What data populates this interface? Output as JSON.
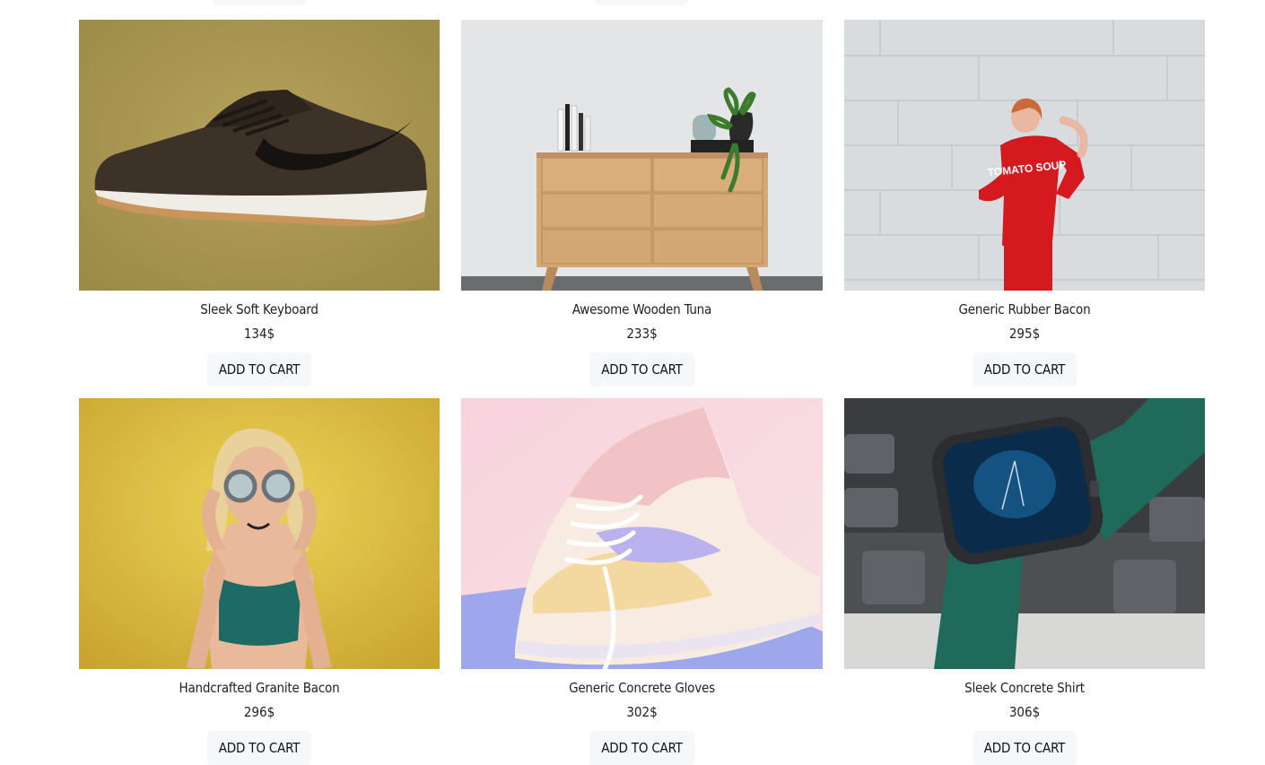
{
  "button_label": "ADD TO CART",
  "products": [
    {
      "name": "",
      "price": ""
    },
    {
      "name": "",
      "price": ""
    },
    {
      "name": "",
      "price": ""
    },
    {
      "name": "Sleek Soft Keyboard",
      "price": "134$",
      "image": "olive background sneaker"
    },
    {
      "name": "Awesome Wooden Tuna",
      "price": "233$",
      "image": "wooden dresser with books and plant"
    },
    {
      "name": "Generic Rubber Bacon",
      "price": "295$",
      "image": "woman in red Tomato Soup sweater"
    },
    {
      "name": "Handcrafted Granite Bacon",
      "price": "296$",
      "image": "woman with round glasses on yellow wall"
    },
    {
      "name": "Generic Concrete Gloves",
      "price": "302$",
      "image": "pastel sneakers"
    },
    {
      "name": "Sleek Concrete Shirt",
      "price": "306$",
      "image": "smartwatch with green strap"
    }
  ],
  "image_text": {
    "sweater": "TOMATO SOUP"
  }
}
